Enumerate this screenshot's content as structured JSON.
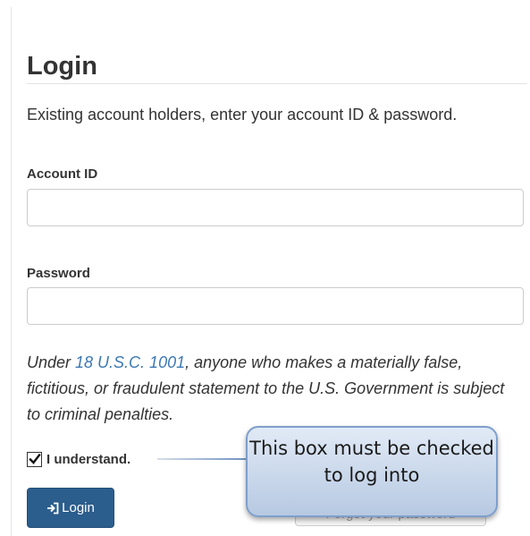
{
  "login": {
    "title": "Login",
    "intro": "Existing account holders, enter your account ID & password.",
    "account_id_label": "Account ID",
    "account_id_value": "",
    "password_label": "Password",
    "password_value": "",
    "warning_prefix": "Under ",
    "warning_link": "18 U.S.C. 1001",
    "warning_suffix": ", anyone who makes a materially false, fictitious, or fraudulent statement to the U.S. Government is subject to criminal penalties.",
    "checkbox_label": "I understand.",
    "checkbox_checked": true,
    "login_button_label": "Login",
    "forgot_button_label": "Forgot your password"
  },
  "callout": {
    "text": "This box must be checked to log into"
  },
  "icons": {
    "login_icon": "sign-in-icon",
    "check_icon": "checkmark-icon"
  },
  "colors": {
    "primary_button": "#2b5d8d",
    "link": "#3c78b4",
    "callout_fill": "#c9d8ec",
    "callout_border": "#7e9fcb"
  }
}
